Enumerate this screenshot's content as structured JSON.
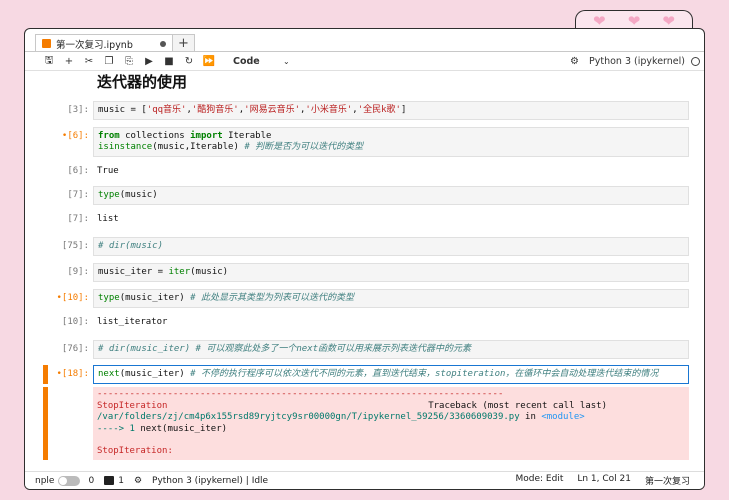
{
  "decor": {
    "hearts": [
      "❤",
      "❤",
      "❤"
    ]
  },
  "tabs": {
    "active_title": "第一次复习.ipynb",
    "add_label": "+"
  },
  "toolbar": {
    "cell_type": "Code",
    "kernel": "Python 3 (ipykernel)"
  },
  "heading": "迭代器的使用",
  "cells": {
    "c3": {
      "prompt": "[3]:",
      "code": {
        "var": "music = [",
        "s1": "'qq音乐'",
        "s2": "'酷狗音乐'",
        "s3": "'网易云音乐'",
        "s4": "'小米音乐'",
        "s5": "'全民k歌'",
        "comma": ",",
        "close": "]"
      }
    },
    "c6": {
      "prompt": "[6]:",
      "l1_kw1": "from",
      "l1_mod": " collections ",
      "l1_kw2": "import",
      "l1_name": " Iterable",
      "l2_fn": "isinstance",
      "l2_args": "(music,Iterable) ",
      "l2_cm": "# 判断是否为可以迭代的类型",
      "out_prompt": "[6]:",
      "out": "True"
    },
    "c7": {
      "prompt": "[7]:",
      "fn": "type",
      "args": "(music)",
      "out_prompt": "[7]:",
      "out": "list"
    },
    "c75": {
      "prompt": "[75]:",
      "cm": "# dir(music)"
    },
    "c9": {
      "prompt": "[9]:",
      "pre": "music_iter = ",
      "fn": "iter",
      "args": "(music)"
    },
    "c10": {
      "prompt": "[10]:",
      "fn": "type",
      "args": "(music_iter) ",
      "cm": "# 此处显示其类型为列表可以迭代的类型",
      "out_prompt": "[10]:",
      "out": "list_iterator"
    },
    "c76": {
      "prompt": "[76]:",
      "cm": "# dir(music_iter) # 可以观察此处多了一个next函数可以用来展示列表迭代器中的元素"
    },
    "c18": {
      "prompt": "[18]:",
      "fn": "next",
      "args": "(music_iter) ",
      "cm": "# 不停的执行程序可以依次迭代不同的元素，直到迭代结束，stopiteration，在循环中会自动处理迭代结束的情况",
      "err": {
        "dashes": "---------------------------------------------------------------------------",
        "name": "StopIteration",
        "traceback": "Traceback (most recent call last)",
        "file": "/var/folders/zj/cm4p6x155rsd89ryjtcy9sr00000gn/T/ipykernel_59256/3360609039.py",
        "in": " in ",
        "module": "<module>",
        "arrow": "----> 1 ",
        "call": "next(music_iter)",
        "final": "StopIteration:"
      }
    }
  },
  "status": {
    "mode_label": "nple",
    "count1": "0",
    "count2": "1",
    "kernel": "Python 3 (ipykernel) | Idle",
    "mode": "Mode: Edit",
    "pos": "Ln 1, Col 21",
    "file": "第一次复习"
  }
}
